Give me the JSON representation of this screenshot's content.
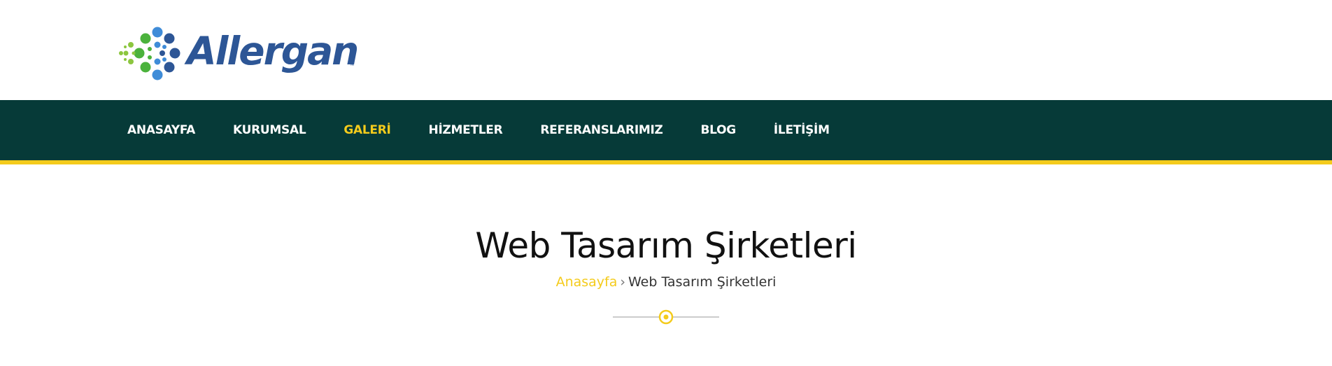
{
  "brand": {
    "name": "Allergan",
    "trademark": "™",
    "colors": {
      "blue": "#2d5696",
      "light_blue": "#3f8cd8",
      "green": "#4bb23c",
      "light_green": "#8cc63f"
    }
  },
  "nav": {
    "items": [
      {
        "label": "ANASAYFA",
        "active": false
      },
      {
        "label": "KURUMSAL",
        "active": false
      },
      {
        "label": "GALERİ",
        "active": true
      },
      {
        "label": "HİZMETLER",
        "active": false
      },
      {
        "label": "REFERANSLARIMIZ",
        "active": false
      },
      {
        "label": "BLOG",
        "active": false
      },
      {
        "label": "İLETİŞİM",
        "active": false
      }
    ],
    "colors": {
      "background": "#063a38",
      "accent": "#f4cb1c",
      "text": "#ffffff"
    }
  },
  "page": {
    "title": "Web Tasarım Şirketleri",
    "breadcrumb": {
      "home": "Anasayfa",
      "separator": "›",
      "current": "Web Tasarım Şirketleri"
    }
  }
}
